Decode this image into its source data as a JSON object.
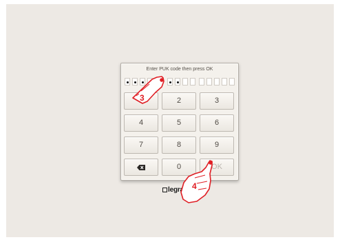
{
  "dialog": {
    "prompt": "Enter PUK code then press OK",
    "code_groups": [
      [
        true,
        true,
        true,
        true,
        true
      ],
      [
        true,
        true,
        false,
        false
      ],
      [
        false,
        false,
        false,
        false,
        false
      ]
    ]
  },
  "keypad": {
    "keys": [
      {
        "label": "1",
        "name": "key-1"
      },
      {
        "label": "2",
        "name": "key-2"
      },
      {
        "label": "3",
        "name": "key-3"
      },
      {
        "label": "4",
        "name": "key-4"
      },
      {
        "label": "5",
        "name": "key-5"
      },
      {
        "label": "6",
        "name": "key-6"
      },
      {
        "label": "7",
        "name": "key-7"
      },
      {
        "label": "8",
        "name": "key-8"
      },
      {
        "label": "9",
        "name": "key-9"
      },
      {
        "label": "",
        "name": "backspace-key",
        "icon": "backspace-icon"
      },
      {
        "label": "0",
        "name": "key-0"
      },
      {
        "label": "OK",
        "name": "ok-button",
        "disabled": true
      }
    ]
  },
  "brand": {
    "logo_text": "legrand"
  },
  "annotations": {
    "step_a": "3",
    "step_b": "4",
    "color": "#e01e24"
  }
}
